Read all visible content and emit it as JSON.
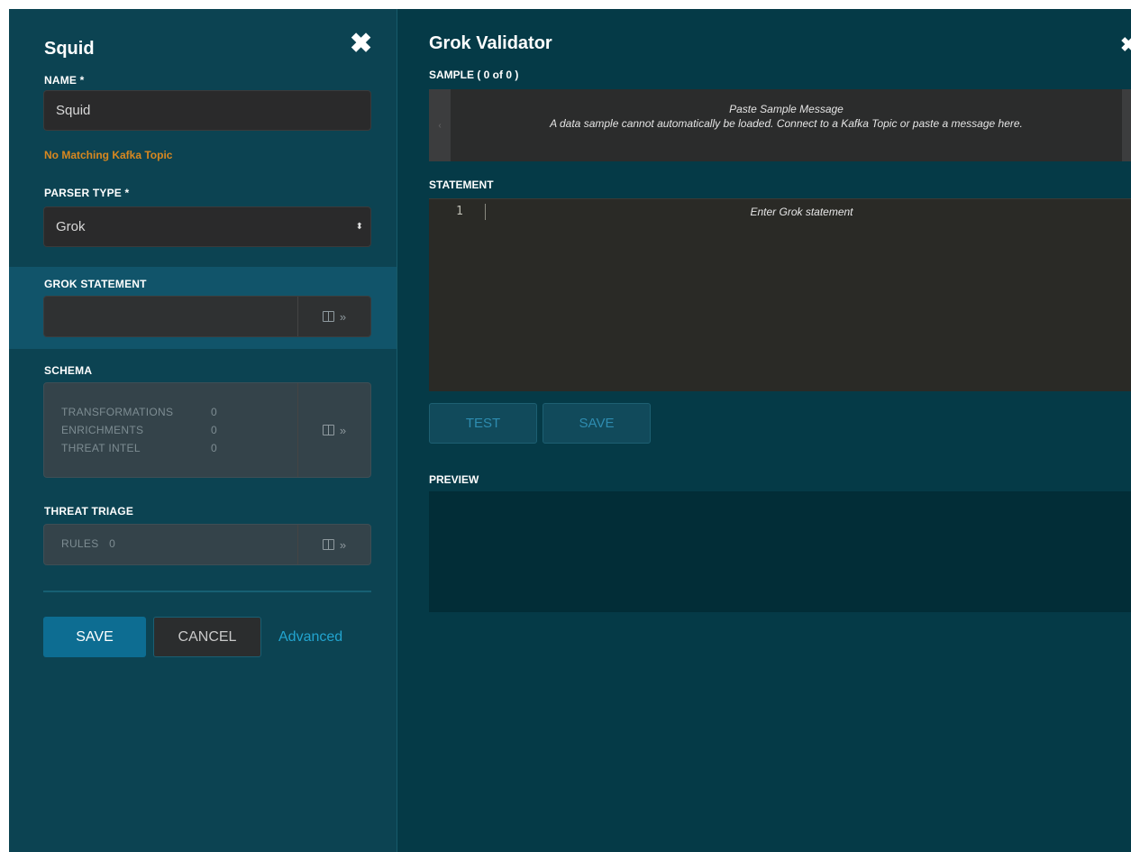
{
  "left_panel": {
    "title": "Squid",
    "close_glyph": "✖",
    "name": {
      "label": "NAME *",
      "value": "Squid"
    },
    "kafka_warning": "No Matching Kafka Topic",
    "parser_type": {
      "label": "PARSER TYPE *",
      "value": "Grok"
    },
    "grok_statement": {
      "label": "GROK STATEMENT",
      "expand_glyph": "»"
    },
    "schema": {
      "label": "SCHEMA",
      "rows": [
        {
          "name": "TRANSFORMATIONS",
          "count": "0"
        },
        {
          "name": "ENRICHMENTS",
          "count": "0"
        },
        {
          "name": "THREAT INTEL",
          "count": "0"
        }
      ]
    },
    "threat_triage": {
      "label": "THREAT TRIAGE",
      "rules_label": "RULES",
      "rules_count": "0"
    },
    "buttons": {
      "save": "SAVE",
      "cancel": "CANCEL",
      "advanced": "Advanced"
    }
  },
  "grok_validator": {
    "title": "Grok Validator",
    "sample_label": "SAMPLE ( 0 of 0 )",
    "sample_title": "Paste Sample Message",
    "sample_message": "A data sample cannot automatically be loaded. Connect to a Kafka Topic or paste a message here.",
    "statement_label": "STATEMENT",
    "line_number": "1",
    "statement_placeholder": "Enter Grok statement",
    "test_button": "TEST",
    "save_button": "SAVE",
    "preview_label": "PREVIEW"
  },
  "icons": [
    "close-icon",
    "select-arrows-icon",
    "book-icon",
    "double-chevron-right-icon"
  ],
  "colors": {
    "background": "#053a47",
    "panel": "#0c4352",
    "highlight": "#11546a",
    "primary_button": "#0d6d92",
    "warning": "#d9881f",
    "link": "#22a4cf"
  }
}
